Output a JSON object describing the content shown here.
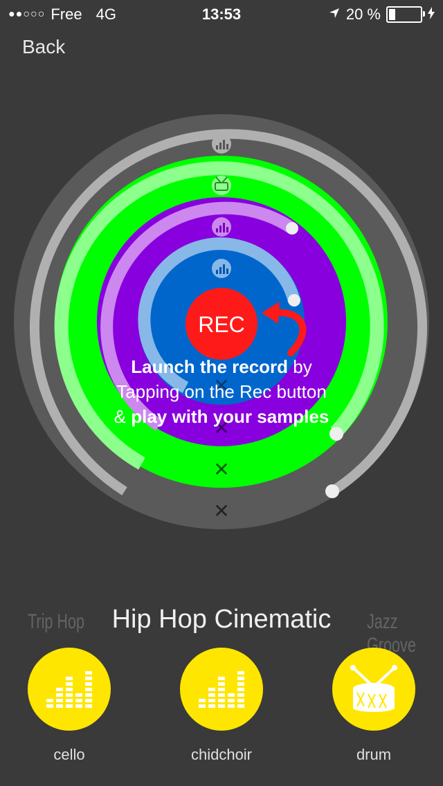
{
  "status": {
    "carrier": "Free",
    "network": "4G",
    "time": "13:53",
    "battery": "20 %",
    "battery_level": 0.2,
    "signal_dots": "●●○○○"
  },
  "nav": {
    "back_label": "Back"
  },
  "wheel": {
    "rec_label": "REC",
    "ring_colors": [
      "#5a5a5a",
      "#00ff00",
      "#8800dd",
      "#0066cc"
    ],
    "track_colors": [
      "#b0b0b0",
      "#88ff88",
      "#cc88ee",
      "#88b8e8"
    ],
    "delete_glyph": "✕"
  },
  "instructions": {
    "line1_bold": "Launch the record",
    "line1_rest": " by",
    "line2": "Tapping on the Rec button",
    "line3_prefix": "& ",
    "line3_bold": "play with your samples"
  },
  "genres": {
    "previous": "Trip Hop",
    "current": "Hip Hop Cinematic",
    "next": "Jazz Groove"
  },
  "samples": [
    {
      "label": "cello",
      "icon": "equalizer-icon"
    },
    {
      "label": "chidchoir",
      "icon": "equalizer-icon"
    },
    {
      "label": "drum",
      "icon": "drum-icon"
    }
  ]
}
